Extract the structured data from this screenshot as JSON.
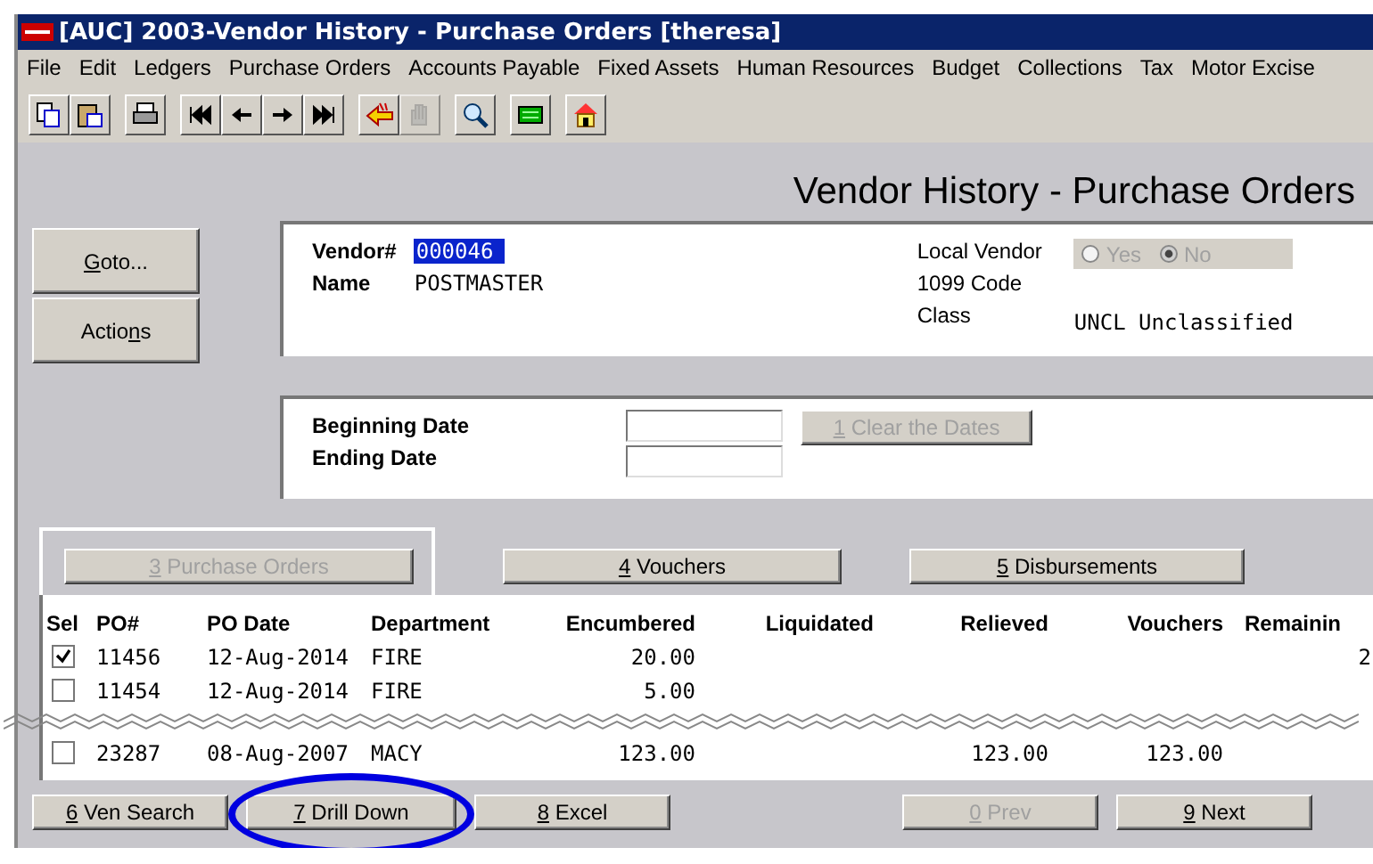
{
  "window": {
    "title": "[AUC] 2003-Vendor History - Purchase Orders [theresa]"
  },
  "menu": [
    "File",
    "Edit",
    "Ledgers",
    "Purchase Orders",
    "Accounts Payable",
    "Fixed Assets",
    "Human Resources",
    "Budget",
    "Collections",
    "Tax",
    "Motor Excise"
  ],
  "toolbar": [
    {
      "kind": "copy",
      "disabled": false
    },
    {
      "kind": "paste",
      "disabled": false
    },
    {
      "kind": "print",
      "disabled": false
    },
    {
      "kind": "first",
      "disabled": false
    },
    {
      "kind": "prev",
      "disabled": false
    },
    {
      "kind": "next",
      "disabled": false
    },
    {
      "kind": "last",
      "disabled": false
    },
    {
      "kind": "back",
      "disabled": false
    },
    {
      "kind": "hand",
      "disabled": true
    },
    {
      "kind": "search",
      "disabled": false
    },
    {
      "kind": "screen",
      "disabled": false
    },
    {
      "kind": "home",
      "disabled": false
    }
  ],
  "heading": "Vendor History - Purchase Orders",
  "side_buttons": [
    {
      "key": "G",
      "post": "oto..."
    },
    {
      "pre": "Actio",
      "key": "n",
      "post": "s"
    }
  ],
  "vendor": {
    "number_label": "Vendor#",
    "number": "000046",
    "name_label": "Name",
    "name": "POSTMASTER",
    "local_vendor_label": "Local Vendor",
    "local_vendor_options": [
      {
        "label": "Yes",
        "selected": false
      },
      {
        "label": "No",
        "selected": true
      }
    ],
    "code_label": "1099 Code",
    "class_label": "Class",
    "class": "UNCL Unclassified"
  },
  "dates": {
    "begin_label": "Beginning Date",
    "end_label": "Ending Date",
    "clear_button": {
      "key": "1",
      "post": " Clear the Dates"
    }
  },
  "tabs": [
    {
      "key": "3",
      "post": " Purchase Orders",
      "selected": true
    },
    {
      "key": "4",
      "post": " Vouchers",
      "selected": false
    },
    {
      "key": "5",
      "post": " Disbursements",
      "selected": false
    }
  ],
  "table": {
    "columns": [
      "Sel",
      "PO#",
      "PO Date",
      "Department",
      "Encumbered",
      "Liquidated",
      "Relieved",
      "Vouchers",
      "Remainin"
    ],
    "rows": [
      {
        "kind": "row",
        "checked": true,
        "po": "11456",
        "date": "12-Aug-2014",
        "department": "FIRE",
        "encumbered": "20.00",
        "remaining": "2"
      },
      {
        "kind": "row",
        "checked": false,
        "po": "11454",
        "date": "12-Aug-2014",
        "department": "FIRE",
        "encumbered": "5.00"
      },
      {
        "kind": "break"
      },
      {
        "kind": "row",
        "checked": false,
        "po": "23287",
        "date": "08-Aug-2007",
        "department": "MACY",
        "encumbered": "123.00",
        "relieved": "123.00",
        "vouchers": "123.00"
      }
    ]
  },
  "buttons": [
    {
      "key": "6",
      "post": " Ven Search",
      "disabled": false,
      "highlighted": false
    },
    {
      "key": "7",
      "post": " Drill Down",
      "disabled": false,
      "highlighted": true
    },
    {
      "key": "8",
      "post": " Excel",
      "disabled": false,
      "highlighted": false
    },
    {
      "key": "0",
      "post": " Prev",
      "disabled": true,
      "highlighted": false
    },
    {
      "key": "9",
      "post": " Next",
      "disabled": false,
      "highlighted": false
    }
  ]
}
